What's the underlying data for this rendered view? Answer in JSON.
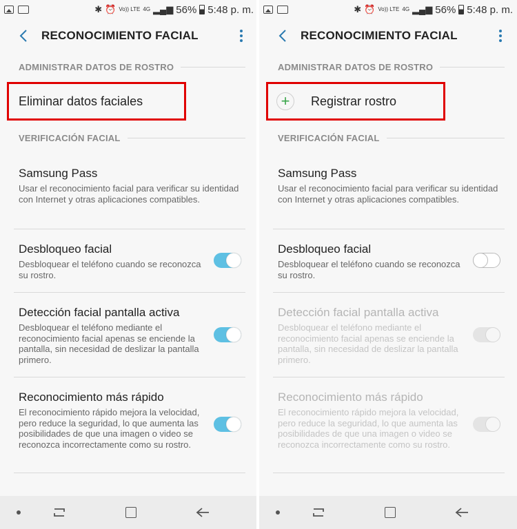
{
  "status_bar": {
    "battery": "56%",
    "time": "5:48 p. m.",
    "volte": "Vo)) LTE",
    "network": "4G"
  },
  "icons": {
    "back": "back-arrow-icon",
    "more": "more-vertical-icon",
    "add": "plus-icon"
  },
  "colors": {
    "accent": "#5ec0e3",
    "highlight_box": "#e00000",
    "plus": "#3aa54a"
  },
  "left": {
    "header": {
      "title": "RECONOCIMIENTO FACIAL"
    },
    "sections": {
      "manage": "ADMINISTRAR DATOS DE ROSTRO",
      "verify": "VERIFICACIÓN FACIAL"
    },
    "action": {
      "label": "Eliminar datos faciales"
    },
    "items": [
      {
        "title": "Samsung Pass",
        "desc": "Usar el reconocimiento facial para verificar su identidad con Internet y otras aplicaciones compatibles."
      },
      {
        "title": "Desbloqueo facial",
        "desc": "Desbloquear el teléfono cuando se reconozca su rostro.",
        "toggle": "on"
      },
      {
        "title": "Detección facial pantalla activa",
        "desc": "Desbloquear el teléfono mediante el reconocimiento facial apenas se enciende la pantalla, sin necesidad de deslizar la pantalla primero.",
        "toggle": "on"
      },
      {
        "title": "Reconocimiento más rápido",
        "desc": "El reconocimiento rápido mejora la velocidad, pero reduce la seguridad, lo que aumenta las posibilidades de que una imagen o video se reconozca incorrectamente como su rostro.",
        "toggle": "on"
      }
    ]
  },
  "right": {
    "header": {
      "title": "RECONOCIMIENTO FACIAL"
    },
    "sections": {
      "manage": "ADMINISTRAR DATOS DE ROSTRO",
      "verify": "VERIFICACIÓN FACIAL"
    },
    "action": {
      "label": "Registrar rostro"
    },
    "items": [
      {
        "title": "Samsung Pass",
        "desc": "Usar el reconocimiento facial para verificar su identidad con Internet y otras aplicaciones compatibles."
      },
      {
        "title": "Desbloqueo facial",
        "desc": "Desbloquear el teléfono cuando se reconozca su rostro.",
        "toggle": "off"
      },
      {
        "title": "Detección facial pantalla activa",
        "desc": "Desbloquear el teléfono mediante el reconocimiento facial apenas se enciende la pantalla, sin necesidad de deslizar la pantalla primero.",
        "toggle": "disabled"
      },
      {
        "title": "Reconocimiento más rápido",
        "desc": "El reconocimiento rápido mejora la velocidad, pero reduce la seguridad, lo que aumenta las posibilidades de que una imagen o video se reconozca incorrectamente como su rostro.",
        "toggle": "disabled"
      }
    ]
  }
}
